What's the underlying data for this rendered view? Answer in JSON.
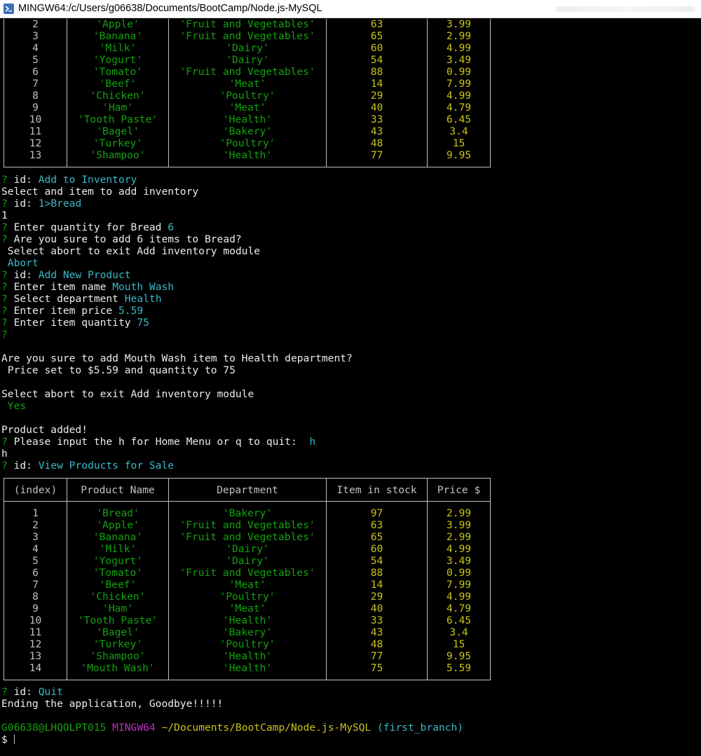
{
  "window": {
    "title": "MINGW64:/c/Users/g06638/Documents/BootCamp/Node.js-MySQL"
  },
  "table_top": {
    "rows": [
      [
        "2",
        "'Apple'",
        "'Fruit and Vegetables'",
        "63",
        "3.99"
      ],
      [
        "3",
        "'Banana'",
        "'Fruit and Vegetables'",
        "65",
        "2.99"
      ],
      [
        "4",
        "'Milk'",
        "'Dairy'",
        "60",
        "4.99"
      ],
      [
        "5",
        "'Yogurt'",
        "'Dairy'",
        "54",
        "3.49"
      ],
      [
        "6",
        "'Tomato'",
        "'Fruit and Vegetables'",
        "88",
        "0.99"
      ],
      [
        "7",
        "'Beef'",
        "'Meat'",
        "14",
        "7.99"
      ],
      [
        "8",
        "'Chicken'",
        "'Poultry'",
        "29",
        "4.99"
      ],
      [
        "9",
        "'Ham'",
        "'Meat'",
        "40",
        "4.79"
      ],
      [
        "10",
        "'Tooth Paste'",
        "'Health'",
        "33",
        "6.45"
      ],
      [
        "11",
        "'Bagel'",
        "'Bakery'",
        "43",
        "3.4"
      ],
      [
        "12",
        "'Turkey'",
        "'Poultry'",
        "48",
        "15"
      ],
      [
        "13",
        "'Shampoo'",
        "'Health'",
        "77",
        "9.95"
      ]
    ]
  },
  "log": {
    "q": "?",
    "id_label": "id:",
    "l1_answer": "Add to Inventory",
    "l2": "Select and item to add inventory",
    "l3_answer": "1>Bread",
    "l4": "1",
    "l5_prompt": "Enter quantity for Bread",
    "l5_answer": "6",
    "l6_prompt": "Are you sure to add 6 items to Bread?",
    "l7": " Select abort to exit Add inventory module",
    "l8_answer": "Abort",
    "l9_answer": "Add New Product",
    "l10_prompt": "Enter item name",
    "l10_answer": "Mouth Wash",
    "l11_prompt": "Select department",
    "l11_answer": "Health",
    "l12_prompt": "Enter item price",
    "l12_answer": "5.59",
    "l13_prompt": "Enter item quantity",
    "l13_answer": "75",
    "l15": "Are you sure to add Mouth Wash item to Health department?",
    "l16": " Price set to $5.59 and quantity to 75",
    "l18": "Select abort to exit Add inventory module",
    "l19_answer": "Yes",
    "l21": "Product added!",
    "l22_prompt": "Please input the h for Home Menu or q to quit:",
    "l22_answer": "h",
    "l23": "h",
    "l24_answer": "View Products for Sale",
    "l_quit_answer": "Quit",
    "l_end": "Ending the application, Goodbye!!!!!",
    "ps_user": "G06638@LHQOLPT015",
    "ps_shell": "MINGW64",
    "ps_path": "~/Documents/BootCamp/Node.js-MySQL",
    "ps_branch": "(first_branch)",
    "ps_dollar": "$"
  },
  "table_bottom": {
    "headers": [
      "(index)",
      "Product Name",
      "Department",
      "Item in stock",
      "Price $"
    ],
    "rows": [
      [
        "1",
        "'Bread'",
        "'Bakery'",
        "97",
        "2.99"
      ],
      [
        "2",
        "'Apple'",
        "'Fruit and Vegetables'",
        "63",
        "3.99"
      ],
      [
        "3",
        "'Banana'",
        "'Fruit and Vegetables'",
        "65",
        "2.99"
      ],
      [
        "4",
        "'Milk'",
        "'Dairy'",
        "60",
        "4.99"
      ],
      [
        "5",
        "'Yogurt'",
        "'Dairy'",
        "54",
        "3.49"
      ],
      [
        "6",
        "'Tomato'",
        "'Fruit and Vegetables'",
        "88",
        "0.99"
      ],
      [
        "7",
        "'Beef'",
        "'Meat'",
        "14",
        "7.99"
      ],
      [
        "8",
        "'Chicken'",
        "'Poultry'",
        "29",
        "4.99"
      ],
      [
        "9",
        "'Ham'",
        "'Meat'",
        "40",
        "4.79"
      ],
      [
        "10",
        "'Tooth Paste'",
        "'Health'",
        "33",
        "6.45"
      ],
      [
        "11",
        "'Bagel'",
        "'Bakery'",
        "43",
        "3.4"
      ],
      [
        "12",
        "'Turkey'",
        "'Poultry'",
        "48",
        "15"
      ],
      [
        "13",
        "'Shampoo'",
        "'Health'",
        "77",
        "9.95"
      ],
      [
        "14",
        "'Mouth Wash'",
        "'Health'",
        "75",
        "5.59"
      ]
    ]
  }
}
